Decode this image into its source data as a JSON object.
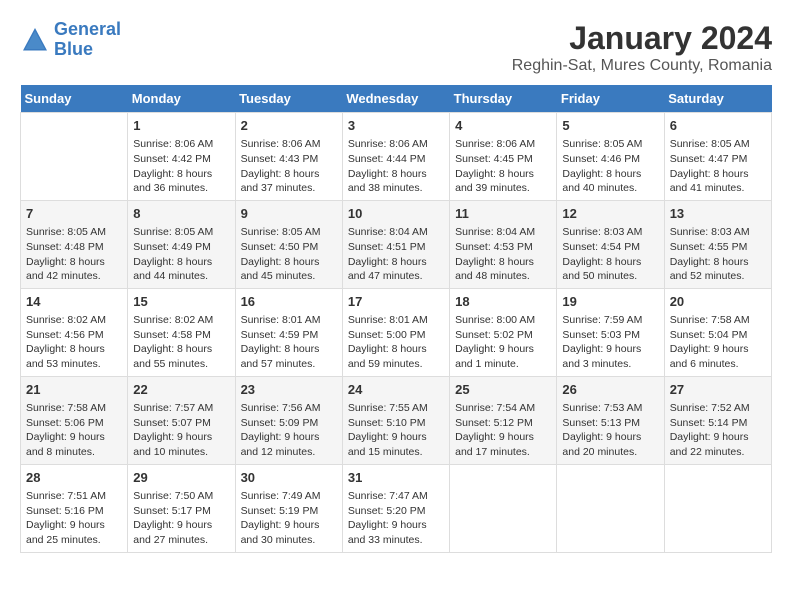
{
  "logo": {
    "line1": "General",
    "line2": "Blue"
  },
  "title": "January 2024",
  "subtitle": "Reghin-Sat, Mures County, Romania",
  "header_color": "#3a7abf",
  "days_of_week": [
    "Sunday",
    "Monday",
    "Tuesday",
    "Wednesday",
    "Thursday",
    "Friday",
    "Saturday"
  ],
  "weeks": [
    [
      {
        "day": "",
        "content": ""
      },
      {
        "day": "1",
        "content": "Sunrise: 8:06 AM\nSunset: 4:42 PM\nDaylight: 8 hours\nand 36 minutes."
      },
      {
        "day": "2",
        "content": "Sunrise: 8:06 AM\nSunset: 4:43 PM\nDaylight: 8 hours\nand 37 minutes."
      },
      {
        "day": "3",
        "content": "Sunrise: 8:06 AM\nSunset: 4:44 PM\nDaylight: 8 hours\nand 38 minutes."
      },
      {
        "day": "4",
        "content": "Sunrise: 8:06 AM\nSunset: 4:45 PM\nDaylight: 8 hours\nand 39 minutes."
      },
      {
        "day": "5",
        "content": "Sunrise: 8:05 AM\nSunset: 4:46 PM\nDaylight: 8 hours\nand 40 minutes."
      },
      {
        "day": "6",
        "content": "Sunrise: 8:05 AM\nSunset: 4:47 PM\nDaylight: 8 hours\nand 41 minutes."
      }
    ],
    [
      {
        "day": "7",
        "content": "Sunrise: 8:05 AM\nSunset: 4:48 PM\nDaylight: 8 hours\nand 42 minutes."
      },
      {
        "day": "8",
        "content": "Sunrise: 8:05 AM\nSunset: 4:49 PM\nDaylight: 8 hours\nand 44 minutes."
      },
      {
        "day": "9",
        "content": "Sunrise: 8:05 AM\nSunset: 4:50 PM\nDaylight: 8 hours\nand 45 minutes."
      },
      {
        "day": "10",
        "content": "Sunrise: 8:04 AM\nSunset: 4:51 PM\nDaylight: 8 hours\nand 47 minutes."
      },
      {
        "day": "11",
        "content": "Sunrise: 8:04 AM\nSunset: 4:53 PM\nDaylight: 8 hours\nand 48 minutes."
      },
      {
        "day": "12",
        "content": "Sunrise: 8:03 AM\nSunset: 4:54 PM\nDaylight: 8 hours\nand 50 minutes."
      },
      {
        "day": "13",
        "content": "Sunrise: 8:03 AM\nSunset: 4:55 PM\nDaylight: 8 hours\nand 52 minutes."
      }
    ],
    [
      {
        "day": "14",
        "content": "Sunrise: 8:02 AM\nSunset: 4:56 PM\nDaylight: 8 hours\nand 53 minutes."
      },
      {
        "day": "15",
        "content": "Sunrise: 8:02 AM\nSunset: 4:58 PM\nDaylight: 8 hours\nand 55 minutes."
      },
      {
        "day": "16",
        "content": "Sunrise: 8:01 AM\nSunset: 4:59 PM\nDaylight: 8 hours\nand 57 minutes."
      },
      {
        "day": "17",
        "content": "Sunrise: 8:01 AM\nSunset: 5:00 PM\nDaylight: 8 hours\nand 59 minutes."
      },
      {
        "day": "18",
        "content": "Sunrise: 8:00 AM\nSunset: 5:02 PM\nDaylight: 9 hours\nand 1 minute."
      },
      {
        "day": "19",
        "content": "Sunrise: 7:59 AM\nSunset: 5:03 PM\nDaylight: 9 hours\nand 3 minutes."
      },
      {
        "day": "20",
        "content": "Sunrise: 7:58 AM\nSunset: 5:04 PM\nDaylight: 9 hours\nand 6 minutes."
      }
    ],
    [
      {
        "day": "21",
        "content": "Sunrise: 7:58 AM\nSunset: 5:06 PM\nDaylight: 9 hours\nand 8 minutes."
      },
      {
        "day": "22",
        "content": "Sunrise: 7:57 AM\nSunset: 5:07 PM\nDaylight: 9 hours\nand 10 minutes."
      },
      {
        "day": "23",
        "content": "Sunrise: 7:56 AM\nSunset: 5:09 PM\nDaylight: 9 hours\nand 12 minutes."
      },
      {
        "day": "24",
        "content": "Sunrise: 7:55 AM\nSunset: 5:10 PM\nDaylight: 9 hours\nand 15 minutes."
      },
      {
        "day": "25",
        "content": "Sunrise: 7:54 AM\nSunset: 5:12 PM\nDaylight: 9 hours\nand 17 minutes."
      },
      {
        "day": "26",
        "content": "Sunrise: 7:53 AM\nSunset: 5:13 PM\nDaylight: 9 hours\nand 20 minutes."
      },
      {
        "day": "27",
        "content": "Sunrise: 7:52 AM\nSunset: 5:14 PM\nDaylight: 9 hours\nand 22 minutes."
      }
    ],
    [
      {
        "day": "28",
        "content": "Sunrise: 7:51 AM\nSunset: 5:16 PM\nDaylight: 9 hours\nand 25 minutes."
      },
      {
        "day": "29",
        "content": "Sunrise: 7:50 AM\nSunset: 5:17 PM\nDaylight: 9 hours\nand 27 minutes."
      },
      {
        "day": "30",
        "content": "Sunrise: 7:49 AM\nSunset: 5:19 PM\nDaylight: 9 hours\nand 30 minutes."
      },
      {
        "day": "31",
        "content": "Sunrise: 7:47 AM\nSunset: 5:20 PM\nDaylight: 9 hours\nand 33 minutes."
      },
      {
        "day": "",
        "content": ""
      },
      {
        "day": "",
        "content": ""
      },
      {
        "day": "",
        "content": ""
      }
    ]
  ]
}
